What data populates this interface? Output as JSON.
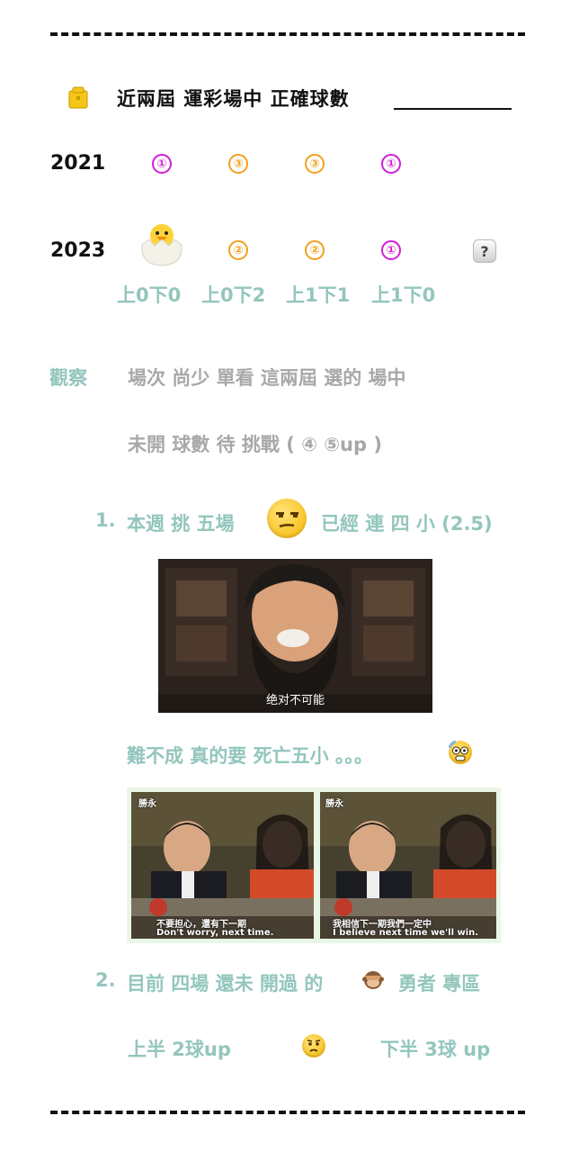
{
  "header": {
    "title": "近兩屆 運彩場中 正確球數"
  },
  "rows": {
    "y2021": {
      "year": "2021",
      "marks": [
        "①",
        "③",
        "③",
        "①"
      ]
    },
    "y2023": {
      "year": "2023",
      "marks": [
        "②",
        "②",
        "①"
      ]
    }
  },
  "scores": [
    "上0下0",
    "上0下2",
    "上1下1",
    "上1下0"
  ],
  "observe": {
    "label": "觀察",
    "line1": "場次 尚少  單看 這兩屆 選的 場中",
    "line2": "未開 球數 待 挑戰  ( ④  ⑤up )"
  },
  "point1": {
    "num": "1.",
    "text_a": "本週 挑 五場",
    "text_b": "已經 連 四 小 (2.5)"
  },
  "image1": {
    "caption": "绝对不可能"
  },
  "line_death": "難不成 真的要 死亡五小 。。。",
  "image2": {
    "logo_left": "勝永",
    "logo_right": "勝永",
    "sub_left_cn": "不要担心，還有下一期",
    "sub_left_en": "Don't worry, next time.",
    "sub_right_cn": "我相信下一期我們一定中",
    "sub_right_en": "I believe next time we'll win."
  },
  "point2": {
    "num": "2.",
    "text_a": "目前 四場 還未 開過 的",
    "text_b": "勇者 專區"
  },
  "bottom": {
    "left": "上半 2球up",
    "right": "下半 3球 up"
  },
  "colors": {
    "teal": "#93c6bd",
    "gray": "#a8a8a8",
    "magenta": "#d11ed6",
    "orange": "#f2a01c"
  },
  "icons": [
    "folder-icon",
    "hatching-chick-icon",
    "question-icon",
    "unamused-face-icon",
    "astonished-face-icon",
    "see-no-evil-monkey-icon",
    "worried-face-icon"
  ]
}
